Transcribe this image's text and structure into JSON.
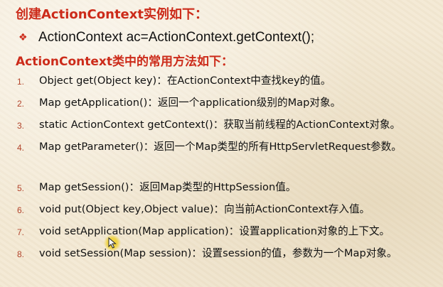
{
  "slide": {
    "title": "创建ActionContext实例如下：",
    "bullet": {
      "icon": "diamond-bullet-icon",
      "text": "ActionContext ac=ActionContext.getContext();"
    },
    "subtitle": "ActionContext类中的常用方法如下：",
    "methods": [
      {
        "num": "1.",
        "text": "Object get(Object key)：在ActionContext中查找key的值。"
      },
      {
        "num": "2.",
        "text": "Map getApplication()：返回一个application级别的Map对象。"
      },
      {
        "num": "3.",
        "text": "static ActionContext getContext()：获取当前线程的ActionContext对象。"
      },
      {
        "num": "4.",
        "text": "Map getParameter()：返回一个Map类型的所有HttpServletRequest参数。"
      },
      {
        "num": "5.",
        "text": "Map getSession()：返回Map类型的HttpSession值。"
      },
      {
        "num": "6.",
        "text": "void put(Object key,Object value)：向当前ActionContext存入值。"
      },
      {
        "num": "7.",
        "text": "void setApplication(Map application)：设置application对象的上下文。"
      },
      {
        "num": "8.",
        "text": "void setSession(Map session)：设置session的值，参数为一个Map对象。"
      }
    ],
    "colors": {
      "accent": "#cc2b1a",
      "background": "#f3e9d4",
      "text": "#111111"
    }
  }
}
